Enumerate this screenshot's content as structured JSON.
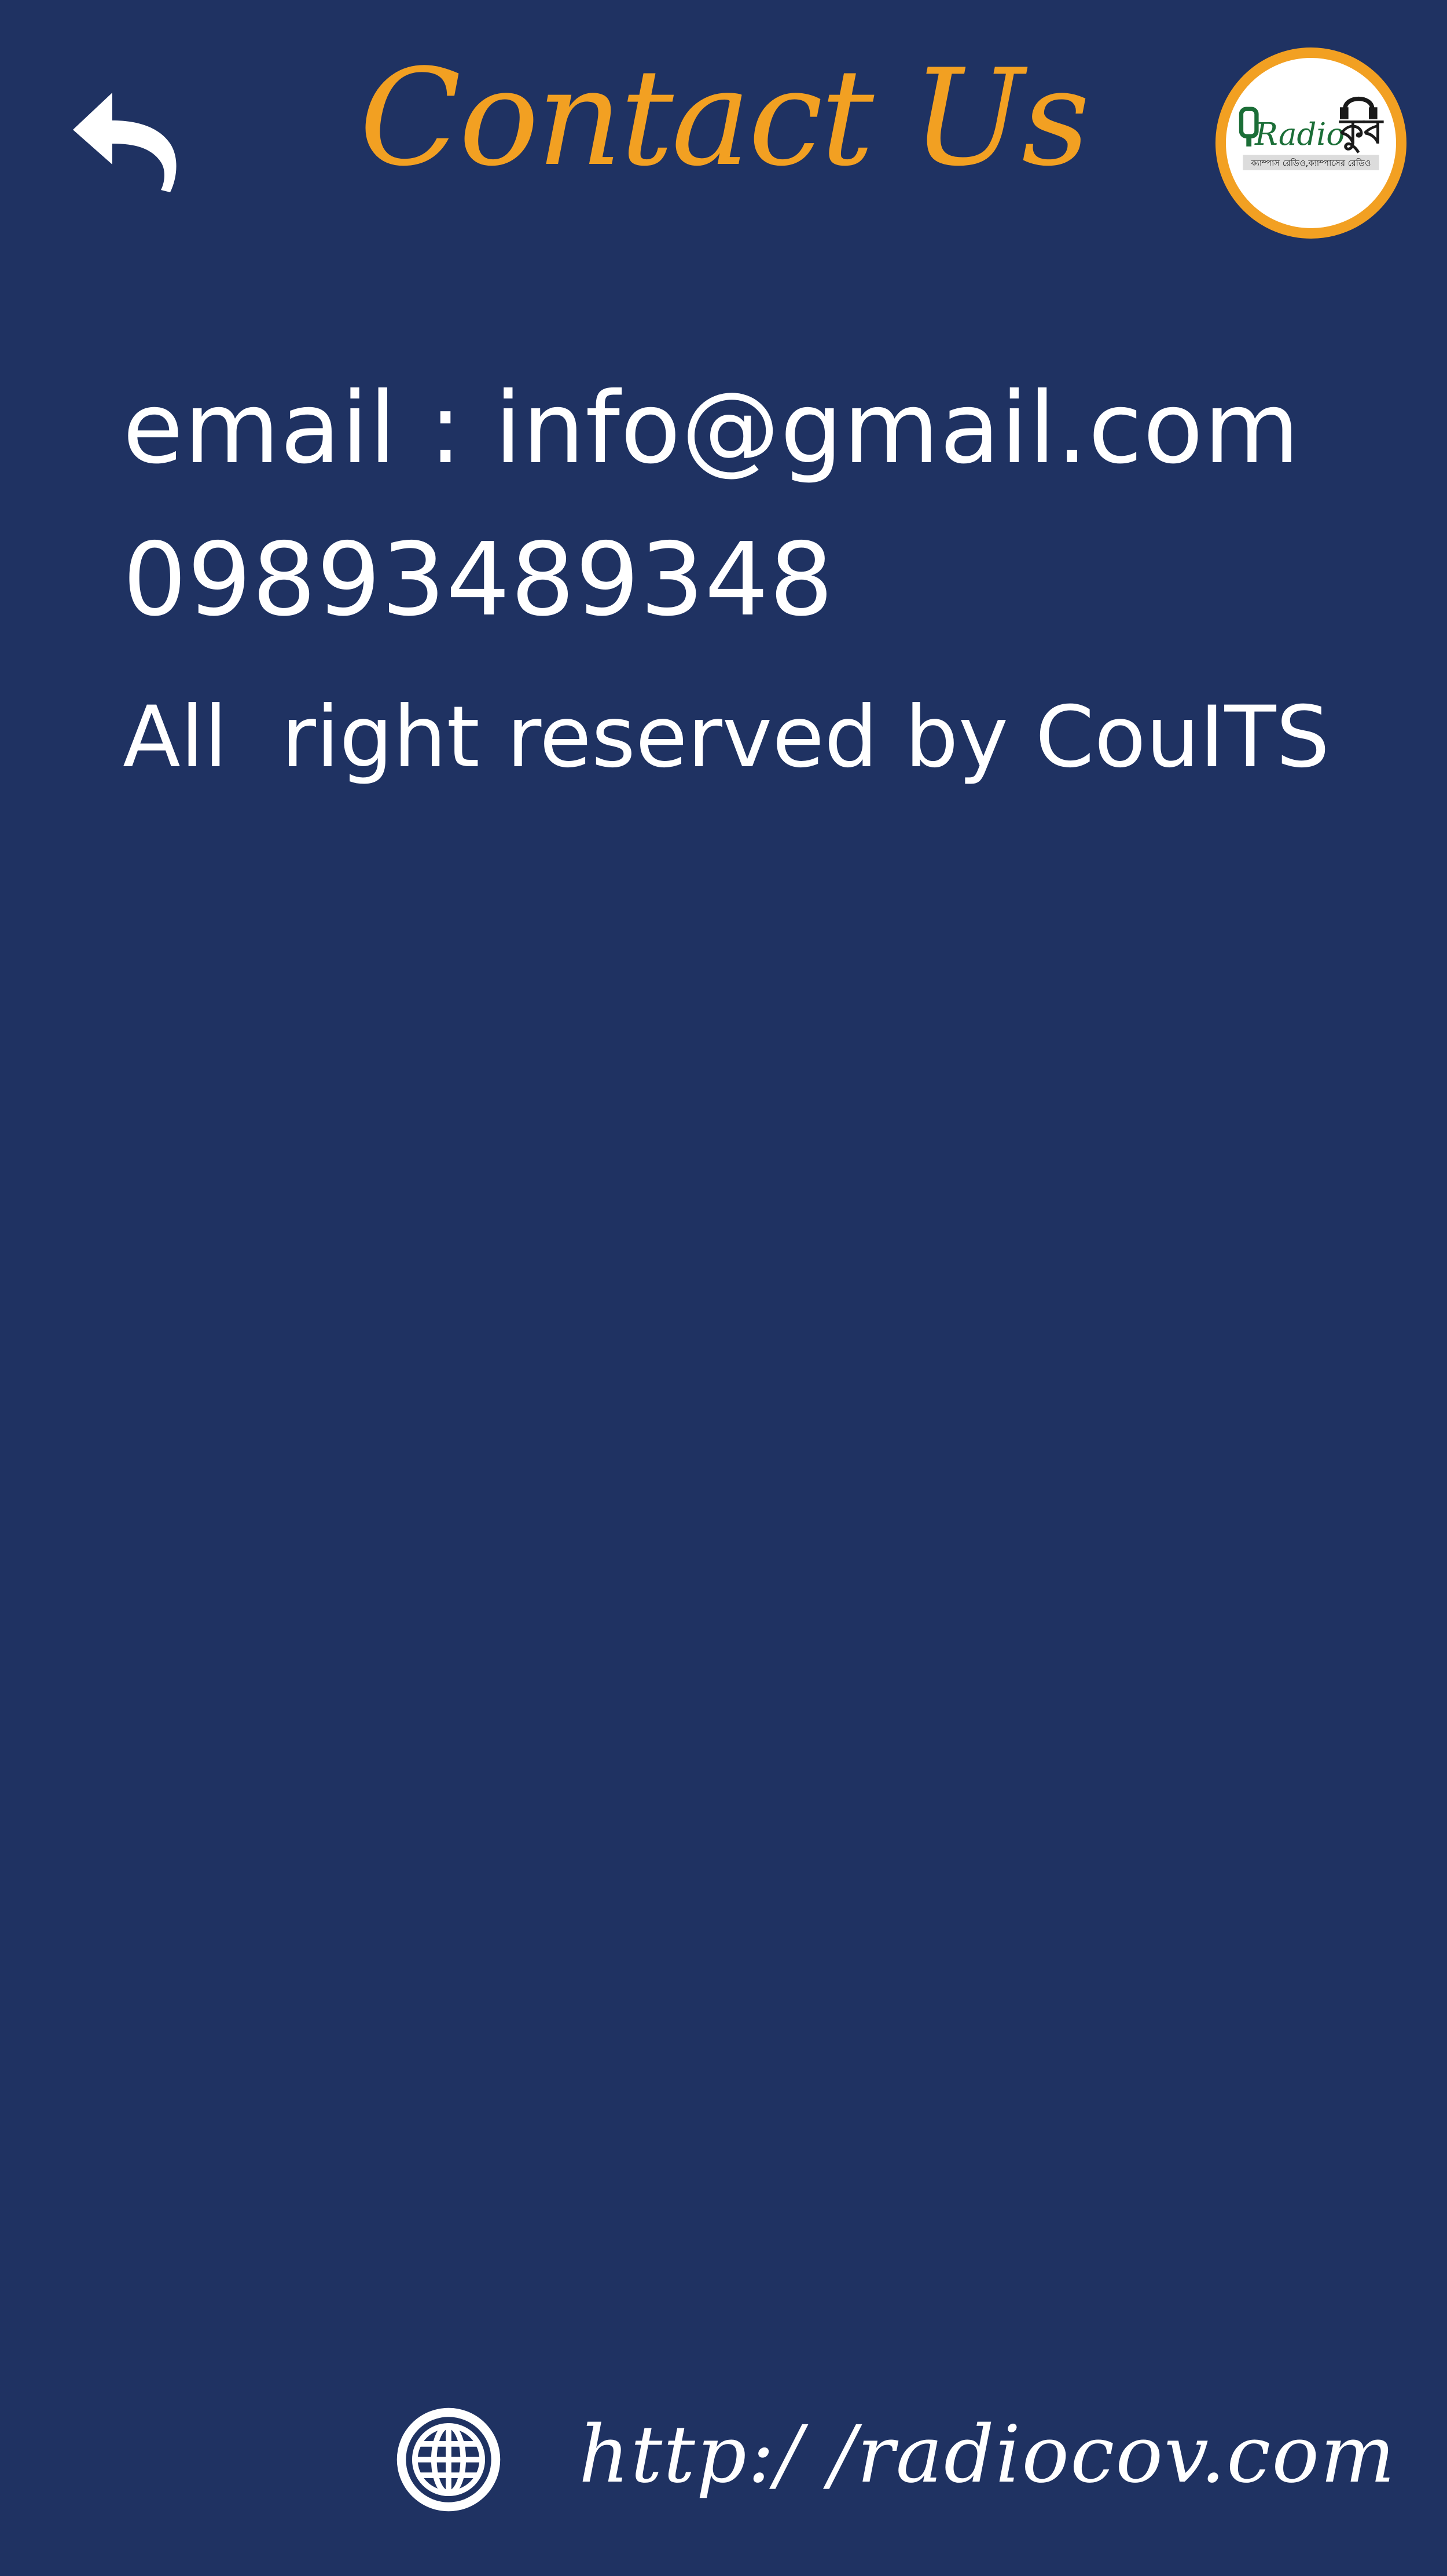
{
  "header": {
    "title": "Contact Us",
    "back_icon": "reply-arrow-icon",
    "logo_text": "Radio",
    "logo_tagline": "ক্যাম্পাস রেডিও,ক্যাম্পাসের রেডিও"
  },
  "contact": {
    "email_line": "email : info@gmail.com",
    "phone": "09893489348",
    "rights": "All  right reserved by CouITS"
  },
  "footer": {
    "globe_icon": "globe-icon",
    "website": "http:/ /radiocov.com"
  },
  "colors": {
    "background": "#1f3262",
    "accent": "#f2a022",
    "text": "#ffffff",
    "logo_green": "#1b6e37"
  }
}
